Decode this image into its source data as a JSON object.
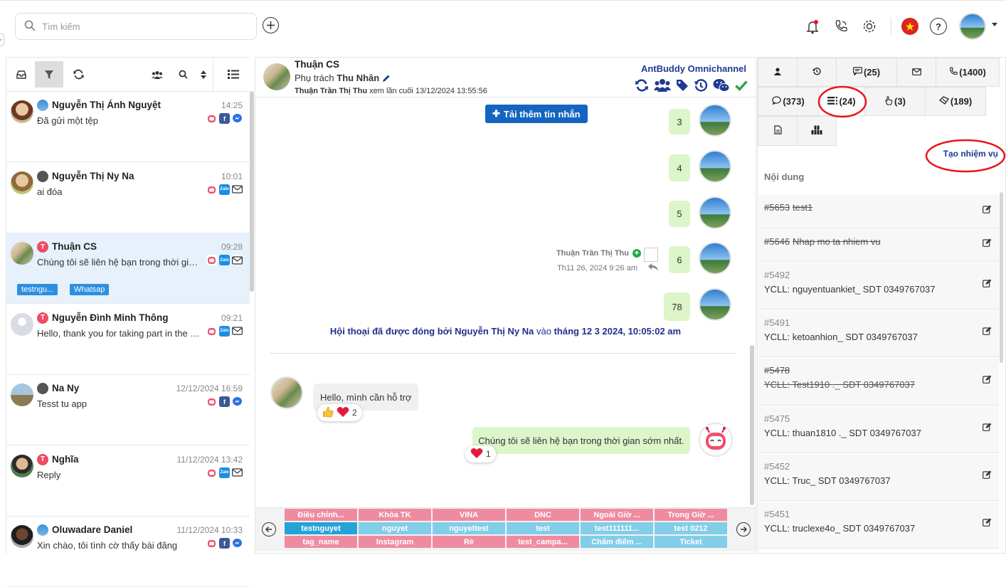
{
  "search": {
    "placeholder": "Tìm kiếm"
  },
  "conversations": [
    {
      "name": "Nguyễn Thị Ánh Nguyệt",
      "time": "14:25",
      "message": "Đã gửi một tệp",
      "chans": [
        "bot",
        "facebook",
        "messenger"
      ]
    },
    {
      "name": "Nguyễn Thị Ny Na",
      "time": "10:01",
      "message": "ai đóa",
      "chans": [
        "bot",
        "zalo",
        "mail"
      ]
    },
    {
      "name": "Thuận CS",
      "time": "09:28",
      "message": "Chúng tôi sẽ liên hệ bạn trong thời gian sớm nhất.",
      "chans": [
        "bot",
        "zalo",
        "mail"
      ],
      "tags": [
        "testngu...",
        "Whatsap"
      ]
    },
    {
      "name": "Nguyễn Đình Minh Thông",
      "time": "09:21",
      "message": "Hello, thank you for taking part in the survey",
      "chans": [
        "bot",
        "zalo",
        "mail"
      ]
    },
    {
      "name": "Na Ny",
      "time": "12/12/2024 16:59",
      "message": "Tesst tu app",
      "chans": [
        "bot",
        "facebook",
        "messenger"
      ]
    },
    {
      "name": "Nghĩa",
      "time": "11/12/2024 13:42",
      "message": "Reply",
      "chans": [
        "bot",
        "zalo",
        "mail"
      ]
    },
    {
      "name": "Oluwadare Daniel",
      "time": "11/12/2024 10:33",
      "message": "Xin chào, tôi tình cờ thấy bài đăng",
      "chans": [
        "bot",
        "facebook",
        "messenger"
      ]
    }
  ],
  "chat": {
    "contact_name": "Thuận CS",
    "owner_label": "Phụ trách",
    "owner_name": "Thu Nhân",
    "last_seen_by": "Thuận Trần Thị Thu",
    "last_seen_text": "xem lần cuối 13/12/2024 13:55:56",
    "channel_name": "AntBuddy Omnichannel",
    "load_more": "Tải thêm tin nhắn",
    "outgoing_numbers": [
      "3",
      "4",
      "5",
      "6",
      "78"
    ],
    "sender_name": "Thuận Trần Thị Thu",
    "sender_time": "Th11 26, 2024 9:26 am",
    "closed_prefix": "Hội thoại đã được đóng bởi",
    "closed_by": "Nguyễn Thị Ny Na",
    "closed_mid": "vào",
    "closed_time": "tháng 12 3 2024, 10:05:02 am",
    "incoming_text": "Hello, mình cần hỗ trợ",
    "incoming_react_count": "2",
    "bot_reply": "Chúng tôi sẽ liên hệ bạn trong thời gian sớm nhất.",
    "bot_react_count": "1"
  },
  "quick_tags": [
    [
      {
        "label": "Điều chỉnh...",
        "color": "#ef8ba1"
      },
      {
        "label": "Khóa TK",
        "color": "#ef8ba1"
      },
      {
        "label": "VINA",
        "color": "#ef8ba1"
      },
      {
        "label": "DNC",
        "color": "#ef8ba1"
      },
      {
        "label": "Ngoài Giờ ...",
        "color": "#ef8ba1"
      },
      {
        "label": "Trong Giờ ...",
        "color": "#ef8ba1"
      }
    ],
    [
      {
        "label": "testnguyet",
        "color": "#25a3d8"
      },
      {
        "label": "nguyet",
        "color": "#82cde8"
      },
      {
        "label": "nguyettest",
        "color": "#82cde8"
      },
      {
        "label": "test",
        "color": "#82cde8"
      },
      {
        "label": "test111111...",
        "color": "#82cde8"
      },
      {
        "label": "test 0212",
        "color": "#82cde8"
      }
    ],
    [
      {
        "label": "tag_name",
        "color": "#ef8ba1"
      },
      {
        "label": "Instagram",
        "color": "#ef8ba1"
      },
      {
        "label": "Rè",
        "color": "#ef8ba1"
      },
      {
        "label": "test_campa...",
        "color": "#ef8ba1"
      },
      {
        "label": "Chấm điểm ...",
        "color": "#82cde8"
      },
      {
        "label": "Ticket",
        "color": "#82cde8"
      }
    ]
  ],
  "right_tabs": {
    "row1": [
      "",
      "",
      "(25)",
      "",
      "(1400)"
    ],
    "row2": [
      "(373)",
      "(24)",
      "(3)",
      "(189)"
    ]
  },
  "tasks": {
    "create_label": "Tạo nhiệm vụ",
    "column_label": "Nội dung",
    "items": [
      {
        "id": "#5653",
        "desc": "test1",
        "done": true
      },
      {
        "id": "#5646",
        "desc": "Nhap mo ta nhiem vu",
        "done": true
      },
      {
        "id": "#5492",
        "desc": "YCLL: nguyentuankiet_ SDT 0349767037",
        "done": false
      },
      {
        "id": "#5491",
        "desc": "YCLL: ketoanhion_ SDT 0349767037",
        "done": false
      },
      {
        "id": "#5478",
        "desc": "YCLL: Test1910 ._ SDT 0349767037",
        "done": true
      },
      {
        "id": "#5475",
        "desc": "YCLL: thuan1810 ._ SDT 0349767037",
        "done": false
      },
      {
        "id": "#5452",
        "desc": "YCLL: Truc_ SDT 0349767037",
        "done": false
      },
      {
        "id": "#5451",
        "desc": "YCLL: truclexe4o_ SDT 0349767037",
        "done": false
      }
    ]
  },
  "colors": {
    "accent": "#1565c0",
    "brand": "#1f3a93",
    "annotation": "#e8161b",
    "closed_text": "#1f2f8c"
  }
}
